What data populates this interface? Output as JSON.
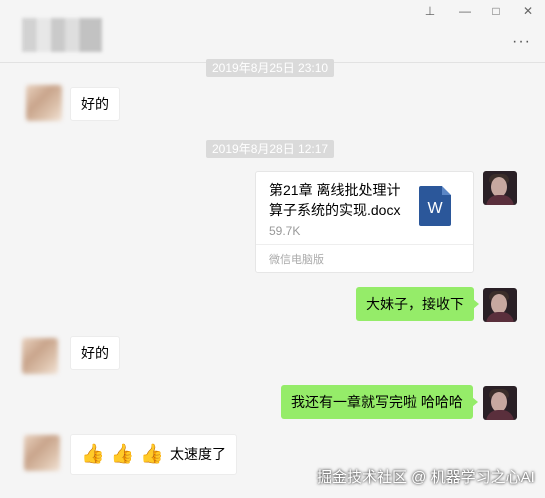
{
  "header": {
    "window_buttons": [
      {
        "name": "pin-icon",
        "glyph": "⊥"
      },
      {
        "name": "minimize-icon",
        "glyph": "—"
      },
      {
        "name": "maximize-icon",
        "glyph": "□"
      },
      {
        "name": "close-icon",
        "glyph": "✕"
      }
    ],
    "more_glyph": "···"
  },
  "messages": {
    "ts1": "2019年8月25日 23:10",
    "msg1": "好的",
    "ts2": "2019年8月28日 12:17",
    "file": {
      "name": "第21章 离线批处理计算子系统的实现.docx",
      "size": "59.7K",
      "source": "微信电脑版",
      "icon_letter": "W",
      "icon_color": "#2b579a"
    },
    "msg2": "大妹子，接收下",
    "msg3": "好的",
    "msg4": "我还有一章就写完啦 哈哈哈",
    "msg5": {
      "emoji": [
        "👍",
        "👍",
        "👍"
      ],
      "text": "太速度了"
    }
  },
  "watermark": "掘金技术社区 @ 机器学习之心AI",
  "colors": {
    "sent_bubble": "#95ec69",
    "received_bubble": "#ffffff",
    "background": "#f5f5f5"
  }
}
